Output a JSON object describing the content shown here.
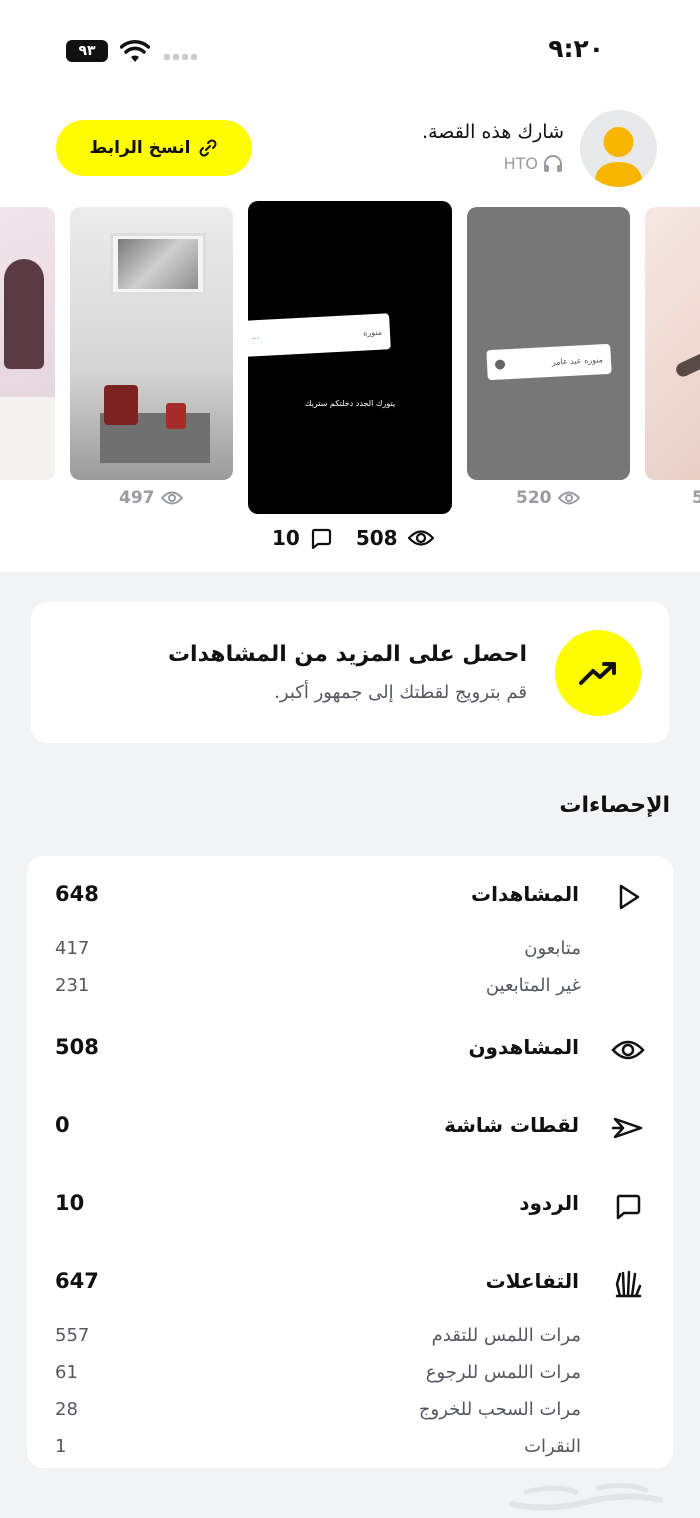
{
  "status_bar": {
    "time": "٩:٢٠",
    "battery": "٩٣"
  },
  "header": {
    "copy_link_label": "انسخ الرابط",
    "share_title": "شارك هذه القصة.",
    "share_subtitle": "HTO"
  },
  "stories": [
    {
      "views": ""
    },
    {
      "views": "497"
    },
    {
      "views": "508",
      "replies": "10",
      "caption": "يتورك الجدد دخلتكم ستريك",
      "sticker": "منوره"
    },
    {
      "views": "520",
      "sticker": "منوره عبد عامر"
    },
    {
      "views": "5"
    }
  ],
  "promo": {
    "title": "احصل على المزيد من المشاهدات",
    "subtitle": "قم بترويج لقطتك إلى جمهور أكبر."
  },
  "insights": {
    "title": "الإحصاءات",
    "views": {
      "label": "المشاهدات",
      "value": "648"
    },
    "followers": {
      "label": "متابعون",
      "value": "417"
    },
    "non_followers": {
      "label": "غير المتابعين",
      "value": "231"
    },
    "viewers": {
      "label": "المشاهدون",
      "value": "508"
    },
    "screenshots": {
      "label": "لقطات شاشة",
      "value": "0"
    },
    "replies": {
      "label": "الردود",
      "value": "10"
    },
    "interactions": {
      "label": "التفاعلات",
      "value": "647"
    },
    "taps_forward": {
      "label": "مرات اللمس للتقدم",
      "value": "557"
    },
    "taps_back": {
      "label": "مرات اللمس للرجوع",
      "value": "61"
    },
    "swipe_exit": {
      "label": "مرات السحب للخروج",
      "value": "28"
    },
    "clicks": {
      "label": "النقرات",
      "value": "1"
    }
  },
  "colors": {
    "accent_yellow": "#fffc00",
    "background": "#f2f3f5"
  }
}
